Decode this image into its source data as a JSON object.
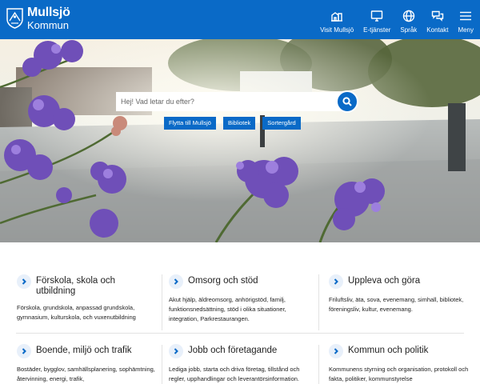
{
  "header": {
    "logo": {
      "name": "Mullsjö",
      "sub": "Kommun"
    },
    "nav": [
      {
        "label": "Visit Mullsjö",
        "icon": "buildings-icon"
      },
      {
        "label": "E-tjänster",
        "icon": "monitor-icon"
      },
      {
        "label": "Språk",
        "icon": "globe-icon"
      },
      {
        "label": "Kontakt",
        "icon": "chat-icon"
      },
      {
        "label": "Meny",
        "icon": "hamburger-icon"
      }
    ]
  },
  "search": {
    "placeholder": "Hej! Vad letar du efter?"
  },
  "quick_links": [
    "Flytta till Mullsjö",
    "Bibliotek",
    "Sortergård"
  ],
  "categories": [
    {
      "title": "Förskola, skola och utbildning",
      "desc": "Förskola, grundskola, anpassad grundskola, gymnasium, kulturskola, och vuxenutbildning"
    },
    {
      "title": "Omsorg och stöd",
      "desc": "Akut hjälp, äldreomsorg, anhörigstöd, familj, funktionsnedsättning, stöd i olika situationer, integration, Parkrestaurangen."
    },
    {
      "title": "Uppleva och göra",
      "desc": "Friluftsliv, äta, sova, evenemang, simhall, bibliotek, föreningsliv, kultur, evenemang."
    },
    {
      "title": "Boende, miljö och trafik",
      "desc": "Bostäder, bygglov, samhällsplanering, sophämtning, återvinning, energi, trafik,"
    },
    {
      "title": "Jobb och företagande",
      "desc": "Lediga jobb, starta och driva företag, tillstånd och regler, upphandlingar och leverantörsinformation."
    },
    {
      "title": "Kommun och politik",
      "desc": "Kommunens styrning och organisation, protokoll och fakta, politiker, kommunstyrelse"
    }
  ],
  "colors": {
    "brand": "#0a6ac7",
    "chevron_bg": "#e8f0fa"
  }
}
